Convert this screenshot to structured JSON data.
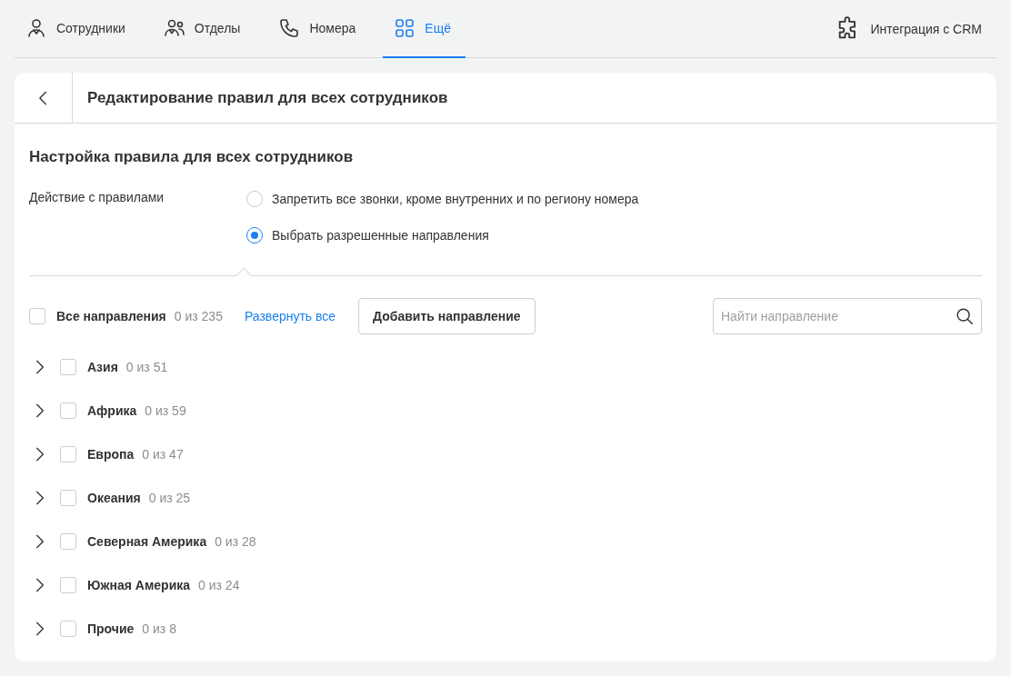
{
  "nav": {
    "tabs": [
      {
        "label": "Сотрудники",
        "selected": false
      },
      {
        "label": "Отделы",
        "selected": false
      },
      {
        "label": "Номера",
        "selected": false
      },
      {
        "label": "Ещё",
        "selected": true
      }
    ],
    "integration": {
      "label": "Интеграция с CRM"
    }
  },
  "page": {
    "title": "Редактирование правил для всех сотрудников"
  },
  "section": {
    "title": "Настройка правила для всех сотрудников",
    "action_label": "Действие с правилами",
    "options": [
      {
        "label": "Запретить все звонки, кроме внутренних и по региону номера",
        "selected": false
      },
      {
        "label": "Выбрать разрешенные направления",
        "selected": true
      }
    ]
  },
  "toolbar": {
    "all": {
      "label": "Все направления",
      "count": "0 из 235",
      "checked": false
    },
    "expand_link": "Развернуть все",
    "add_button": "Добавить направление",
    "search": {
      "placeholder": "Найти направление"
    }
  },
  "tree": [
    {
      "name": "Азия",
      "count": "0 из 51",
      "checked": false,
      "expanded": false
    },
    {
      "name": "Африка",
      "count": "0 из 59",
      "checked": false,
      "expanded": false
    },
    {
      "name": "Европа",
      "count": "0 из 47",
      "checked": false,
      "expanded": false
    },
    {
      "name": "Океания",
      "count": "0 из 25",
      "checked": false,
      "expanded": false
    },
    {
      "name": "Северная Америка",
      "count": "0 из 28",
      "checked": false,
      "expanded": false
    },
    {
      "name": "Южная Америка",
      "count": "0 из 24",
      "checked": false,
      "expanded": false
    },
    {
      "name": "Прочие",
      "count": "0 из 8",
      "checked": false,
      "expanded": false
    }
  ]
}
